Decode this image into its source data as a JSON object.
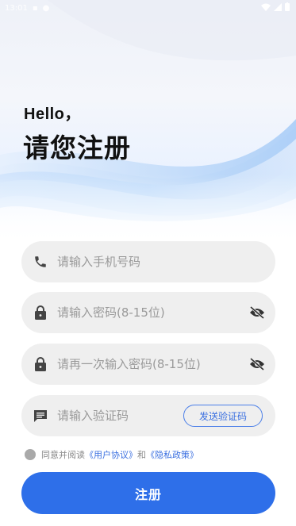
{
  "status_bar": {
    "time": "13:01",
    "icons": [
      "notification-icon",
      "wifi-icon",
      "signal-icon",
      "battery-icon"
    ]
  },
  "header": {
    "greeting": "Hello，",
    "title": "请您注册"
  },
  "form": {
    "phone": {
      "placeholder": "请输入手机号码",
      "icon": "phone-icon"
    },
    "password": {
      "placeholder": "请输入密码(8-15位)",
      "icon": "lock-icon",
      "toggle_icon": "eye-off-icon"
    },
    "password_confirm": {
      "placeholder": "请再一次输入密码(8-15位)",
      "icon": "lock-icon",
      "toggle_icon": "eye-off-icon"
    },
    "code": {
      "placeholder": "请输入验证码",
      "icon": "message-icon",
      "send_label": "发送验证码"
    }
  },
  "agreement": {
    "prefix": "同意并阅读",
    "user_agreement": "《用户协议》",
    "conjunction": "和",
    "privacy_policy": "《隐私政策》"
  },
  "submit_label": "注册",
  "colors": {
    "accent": "#2e6fe9",
    "field_bg": "#efefef",
    "link": "#3a6fe0"
  }
}
